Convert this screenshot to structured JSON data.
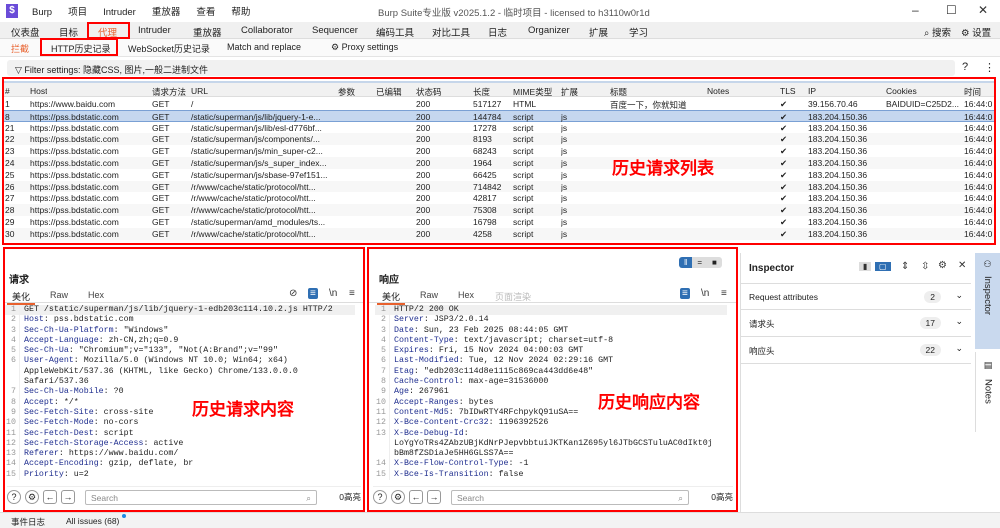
{
  "app": {
    "logo": "$",
    "menu": [
      "Burp",
      "项目",
      "Intruder",
      "重放器",
      "查看",
      "帮助"
    ],
    "title": "Burp Suite专业版  v2025.1.2 - 临时项目 - licensed to h3110w0r1d"
  },
  "tabs": [
    "仪表盘",
    "目标",
    "代理",
    "Intruder",
    "重放器",
    "Collaborator",
    "Sequencer",
    "编码工具",
    "对比工具",
    "日志",
    "Organizer",
    "扩展",
    "学习"
  ],
  "top_right": {
    "search": "搜索",
    "settings": "设置"
  },
  "subtabs": [
    "拦截",
    "HTTP历史记录",
    "WebSocket历史记录",
    "Match and replace",
    "Proxy settings"
  ],
  "filter": "Filter settings: 隐藏CSS, 图片,一般二进制文件",
  "table": {
    "headers": [
      "#",
      "Host",
      "请求方法",
      "URL",
      "参数",
      "已编辑",
      "状态码",
      "长度",
      "MIME类型",
      "扩展",
      "标题",
      "Notes",
      "TLS",
      "IP",
      "Cookies",
      "时间"
    ],
    "rows": [
      [
        "1",
        "https://www.baidu.com",
        "GET",
        "/",
        "",
        "",
        "200",
        "517127",
        "HTML",
        "",
        "百度一下，你就知道",
        "",
        "✔",
        "39.156.70.46",
        "BAIDUID=C25D2...",
        "16:44:0"
      ],
      [
        "8",
        "https://pss.bdstatic.com",
        "GET",
        "/static/superman/js/lib/jquery-1-e...",
        "",
        "",
        "200",
        "144784",
        "script",
        "js",
        "",
        "",
        "✔",
        "183.204.150.36",
        "",
        "16:44:0"
      ],
      [
        "21",
        "https://pss.bdstatic.com",
        "GET",
        "/static/superman/js/lib/esl-d776bf...",
        "",
        "",
        "200",
        "17278",
        "script",
        "js",
        "",
        "",
        "✔",
        "183.204.150.36",
        "",
        "16:44:0"
      ],
      [
        "22",
        "https://pss.bdstatic.com",
        "GET",
        "/static/superman/js/components/...",
        "",
        "",
        "200",
        "8193",
        "script",
        "js",
        "",
        "",
        "✔",
        "183.204.150.36",
        "",
        "16:44:0"
      ],
      [
        "23",
        "https://pss.bdstatic.com",
        "GET",
        "/static/superman/js/min_super-c2...",
        "",
        "",
        "200",
        "68243",
        "script",
        "js",
        "",
        "",
        "✔",
        "183.204.150.36",
        "",
        "16:44:0"
      ],
      [
        "24",
        "https://pss.bdstatic.com",
        "GET",
        "/static/superman/js/s_super_index...",
        "",
        "",
        "200",
        "1964",
        "script",
        "js",
        "",
        "",
        "✔",
        "183.204.150.36",
        "",
        "16:44:0"
      ],
      [
        "25",
        "https://pss.bdstatic.com",
        "GET",
        "/static/superman/js/sbase-97ef151...",
        "",
        "",
        "200",
        "66425",
        "script",
        "js",
        "",
        "",
        "✔",
        "183.204.150.36",
        "",
        "16:44:0"
      ],
      [
        "26",
        "https://pss.bdstatic.com",
        "GET",
        "/r/www/cache/static/protocol/htt...",
        "",
        "",
        "200",
        "714842",
        "script",
        "js",
        "",
        "",
        "✔",
        "183.204.150.36",
        "",
        "16:44:0"
      ],
      [
        "27",
        "https://pss.bdstatic.com",
        "GET",
        "/r/www/cache/static/protocol/htt...",
        "",
        "",
        "200",
        "42817",
        "script",
        "js",
        "",
        "",
        "✔",
        "183.204.150.36",
        "",
        "16:44:0"
      ],
      [
        "28",
        "https://pss.bdstatic.com",
        "GET",
        "/r/www/cache/static/protocol/htt...",
        "",
        "",
        "200",
        "75308",
        "script",
        "js",
        "",
        "",
        "✔",
        "183.204.150.36",
        "",
        "16:44:0"
      ],
      [
        "29",
        "https://pss.bdstatic.com",
        "GET",
        "/static/superman/amd_modules/ts...",
        "",
        "",
        "200",
        "16798",
        "script",
        "js",
        "",
        "",
        "✔",
        "183.204.150.36",
        "",
        "16:44:0"
      ],
      [
        "30",
        "https://pss.bdstatic.com",
        "GET",
        "/r/www/cache/static/protocol/htt...",
        "",
        "",
        "200",
        "4258",
        "script",
        "js",
        "",
        "",
        "✔",
        "183.204.150.36",
        "",
        "16:44:0"
      ]
    ]
  },
  "request": {
    "title": "请求",
    "tabs": [
      "美化",
      "Raw",
      "Hex"
    ],
    "lines": [
      [
        "1",
        "",
        "GET /static/superman/js/lib/jquery-1-edb203c114.10.2.js HTTP/2"
      ],
      [
        "2",
        "Host",
        ": pss.bdstatic.com"
      ],
      [
        "3",
        "Sec-Ch-Ua-Platform",
        ": \"Windows\""
      ],
      [
        "4",
        "Accept-Language",
        ": zh-CN,zh;q=0.9"
      ],
      [
        "5",
        "Sec-Ch-Ua",
        ": \"Chromium\";v=\"133\", \"Not(A:Brand\";v=\"99\""
      ],
      [
        "6",
        "User-Agent",
        ": Mozilla/5.0 (Windows NT 10.0; Win64; x64)"
      ],
      [
        "",
        "",
        "AppleWebKit/537.36 (KHTML, like Gecko) Chrome/133.0.0.0"
      ],
      [
        "",
        "",
        "Safari/537.36"
      ],
      [
        "7",
        "Sec-Ch-Ua-Mobile",
        ": ?0"
      ],
      [
        "8",
        "Accept",
        ": */*"
      ],
      [
        "9",
        "Sec-Fetch-Site",
        ": cross-site"
      ],
      [
        "10",
        "Sec-Fetch-Mode",
        ": no-cors"
      ],
      [
        "11",
        "Sec-Fetch-Dest",
        ": script"
      ],
      [
        "12",
        "Sec-Fetch-Storage-Access",
        ": active"
      ],
      [
        "13",
        "Referer",
        ": https://www.baidu.com/"
      ],
      [
        "14",
        "Accept-Encoding",
        ": gzip, deflate, br"
      ],
      [
        "15",
        "Priority",
        ": u=2"
      ]
    ],
    "search_placeholder": "Search",
    "matches": "0高亮"
  },
  "response": {
    "title": "响应",
    "tabs": [
      "美化",
      "Raw",
      "Hex",
      "页面渲染"
    ],
    "lines": [
      [
        "1",
        "",
        "HTTP/2 200 OK"
      ],
      [
        "2",
        "Server",
        ": JSP3/2.0.14"
      ],
      [
        "3",
        "Date",
        ": Sun, 23 Feb 2025 08:44:05 GMT"
      ],
      [
        "4",
        "Content-Type",
        ": text/javascript; charset=utf-8"
      ],
      [
        "5",
        "Expires",
        ": Fri, 15 Nov 2024 04:00:03 GMT"
      ],
      [
        "6",
        "Last-Modified",
        ": Tue, 12 Nov 2024 02:29:16 GMT"
      ],
      [
        "7",
        "Etag",
        ": \"edb203c114d8e1115c869ca443dd6e48\""
      ],
      [
        "8",
        "Cache-Control",
        ": max-age=31536000"
      ],
      [
        "9",
        "Age",
        ": 267961"
      ],
      [
        "10",
        "Accept-Ranges",
        ": bytes"
      ],
      [
        "11",
        "Content-Md5",
        ": 7bIDwRTY4RFchpykQ91uSA=="
      ],
      [
        "12",
        "X-Bce-Content-Crc32",
        ": 1196392526"
      ],
      [
        "13",
        "X-Bce-Debug-Id",
        ":"
      ],
      [
        "",
        "",
        "LoYgYoTRs4ZAbzUBjKdNrPJepvbbtuiJKTKan1Z695yl6JTbGCSTuluAC0dIkt0j"
      ],
      [
        "",
        "",
        "bBm8fZSDiaJe5HH6GLSS7A=="
      ],
      [
        "14",
        "X-Bce-Flow-Control-Type",
        ": -1"
      ],
      [
        "15",
        "X-Bce-Is-Transition",
        ": false"
      ]
    ],
    "search_placeholder": "Search",
    "matches": "0高亮"
  },
  "inspector": {
    "title": "Inspector",
    "sections": [
      {
        "label": "Request attributes",
        "count": "2"
      },
      {
        "label": "请求头",
        "count": "17"
      },
      {
        "label": "响应头",
        "count": "22"
      }
    ]
  },
  "side_tabs": [
    "Inspector",
    "Notes"
  ],
  "status": {
    "event_log": "事件日志",
    "issues": "All issues (68)"
  },
  "annotations": {
    "list": "历史请求列表",
    "request": "历史请求内容",
    "response": "历史响应内容"
  },
  "colors": {
    "accent": "#e8602c",
    "highlight_box": "#ff0000",
    "selected_row": "#c5d7ef",
    "header_key": "#1f2e8f"
  }
}
